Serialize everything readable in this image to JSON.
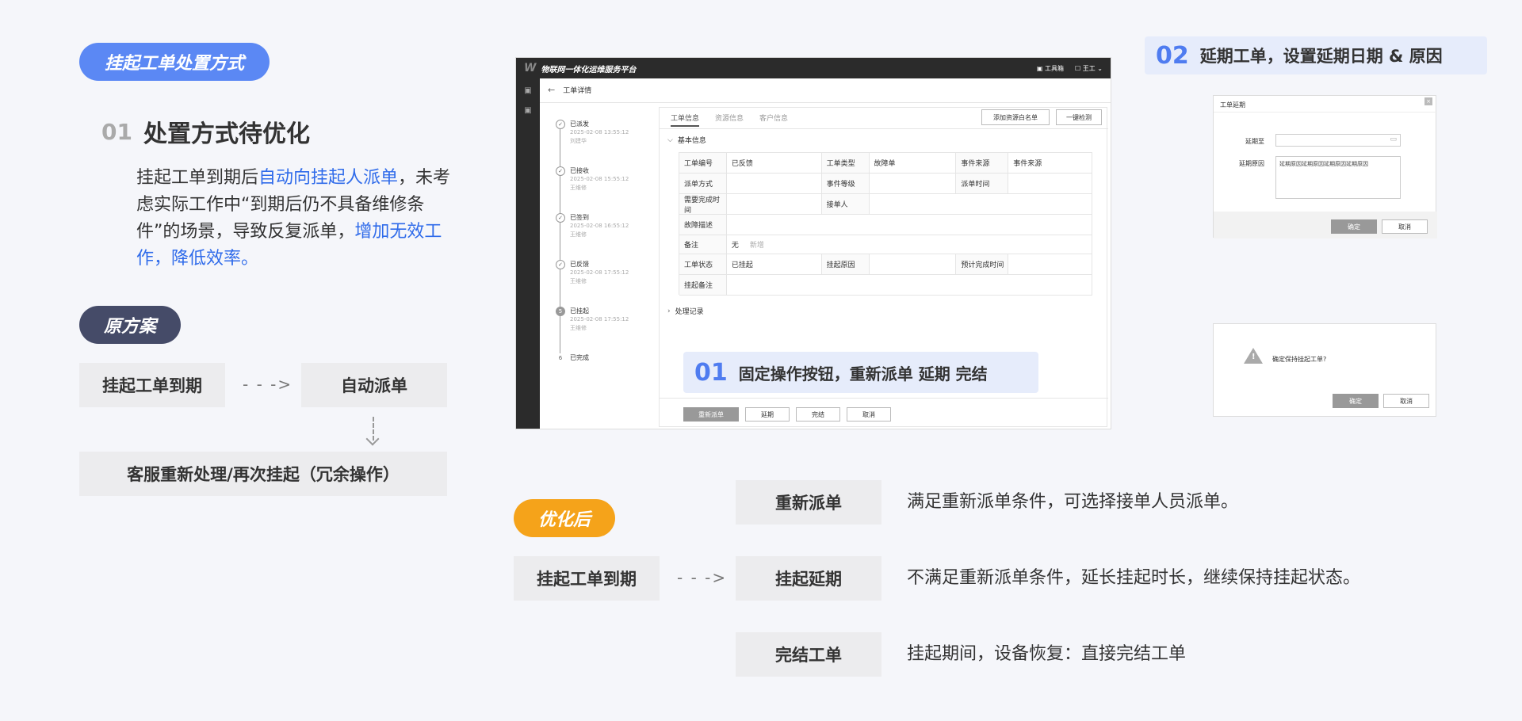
{
  "left": {
    "title_pill": "挂起工单处置方式",
    "issue_num": "01",
    "issue_title": "处置方式待优化",
    "desc_p1": "挂起工单到期后",
    "desc_hl1": "自动向挂起人派单",
    "desc_p2": "，未考虑实际工作中“到期后仍不具备维修条件”的场景，导致反复派单，",
    "desc_hl2": "增加无效工作，降低效率。",
    "orig_pill": "原方案",
    "orig_box1": "挂起工单到期",
    "orig_arrow": "- - ->",
    "orig_box2": "自动派单",
    "orig_box3": "客服重新处理/再次挂起（冗余操作）"
  },
  "optimized": {
    "pill": "优化后",
    "start_box": "挂起工单到期",
    "arrow": "- - ->",
    "options": [
      {
        "label": "重新派单",
        "desc": "满足重新派单条件，可选择接单人员派单。"
      },
      {
        "label": "挂起延期",
        "desc": "不满足重新派单条件，延长挂起时长，继续保持挂起状态。"
      },
      {
        "label": "完结工单",
        "desc": "挂起期间，设备恢复：直接完结工单"
      }
    ]
  },
  "mock": {
    "app_title": "物联网一体化运维服务平台",
    "toolbox": "工具箱",
    "user": "王工",
    "back_title": "工单详情",
    "tabs": [
      "工单信息",
      "资源信息",
      "客户信息"
    ],
    "top_buttons": [
      "添加资源白名单",
      "一键检测"
    ],
    "section_basic": "基本信息",
    "section_record": "处理记录",
    "timeline": [
      {
        "status": "已派发",
        "time": "2025-02-08 13:55:12",
        "person": "刘建华"
      },
      {
        "status": "已接收",
        "time": "2025-02-08 15:55:12",
        "person": "王维修"
      },
      {
        "status": "已签到",
        "time": "2025-02-08 16:55:12",
        "person": "王维修"
      },
      {
        "status": "已反馈",
        "time": "2025-02-08 17:55:12",
        "person": "王维修"
      },
      {
        "status": "已挂起",
        "time": "2025-02-08 17:55:12",
        "person": "王维修",
        "num": "5"
      },
      {
        "status": "已完成",
        "time": "",
        "person": "",
        "num": "6"
      }
    ],
    "table": {
      "r1": [
        "工单编号",
        "已反馈",
        "工单类型",
        "故障单",
        "事件来源",
        "事件来源"
      ],
      "r2": [
        "派单方式",
        "",
        "事件等级",
        "",
        "派单时间",
        ""
      ],
      "r3": [
        "需要完成时间",
        "",
        "接单人",
        ""
      ],
      "r4": [
        "故障描述",
        ""
      ],
      "r5_label": "备注",
      "r5_v1": "无",
      "r5_v2": "新增",
      "r6": [
        "工单状态",
        "已挂起",
        "挂起原因",
        "",
        "预计完成时间",
        ""
      ],
      "r7": [
        "挂起备注",
        ""
      ]
    },
    "callout_num": "01",
    "callout_text": "固定操作按钮，重新派单 延期 完结",
    "bottom_buttons": [
      "重新派单",
      "延期",
      "完结",
      "取消"
    ]
  },
  "delay": {
    "num": "02",
    "title": "延期工单，设置延期日期 & 原因",
    "dialog_title": "工单延期",
    "field1": "延期至",
    "field2": "延期原因",
    "reason_text": "延期原因延期原因延期原因延期原因",
    "ok": "确定",
    "cancel": "取消",
    "confirm_text": "确定保持挂起工单?",
    "ok2": "确定",
    "cancel2": "取消"
  },
  "colors": {
    "blue": "#4f7cf0",
    "navy": "#454b68",
    "orange": "#f5a31a",
    "highlight": "#2f6bea"
  }
}
